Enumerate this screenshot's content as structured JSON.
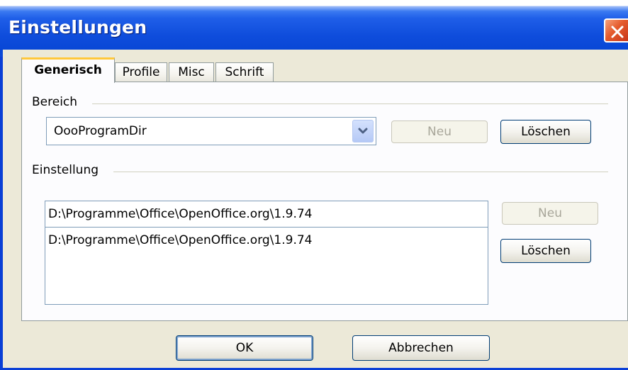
{
  "window": {
    "title": "Einstellungen"
  },
  "tabs": [
    {
      "label": "Generisch",
      "active": true
    },
    {
      "label": "Profile",
      "active": false
    },
    {
      "label": "Misc",
      "active": false
    },
    {
      "label": "Schrift",
      "active": false
    }
  ],
  "bereich": {
    "label": "Bereich",
    "selected": "OooProgramDir",
    "new_label": "Neu",
    "delete_label": "Löschen"
  },
  "einstellung": {
    "label": "Einstellung",
    "value": "D:\\Programme\\Office\\OpenOffice.org\\1.9.74",
    "list_items": [
      "D:\\Programme\\Office\\OpenOffice.org\\1.9.74"
    ],
    "new_label": "Neu",
    "delete_label": "Löschen"
  },
  "footer": {
    "ok_label": "OK",
    "cancel_label": "Abbrechen"
  },
  "colors": {
    "titlebar": "#0f4ddc",
    "dialog_bg": "#ece9d8",
    "active_tab_accent": "#ffc83c",
    "close_button": "#e45a2c"
  },
  "icons": {
    "close": "close-x-icon",
    "dropdown": "chevron-down-icon"
  }
}
